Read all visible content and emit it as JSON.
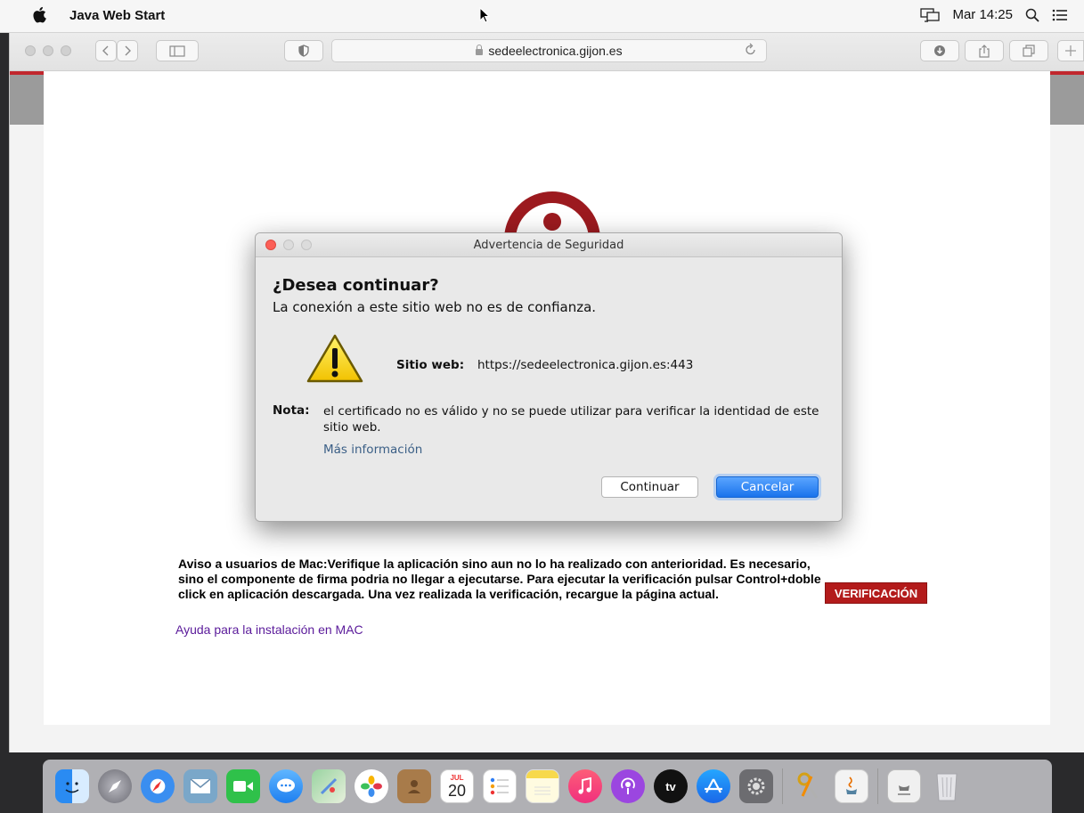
{
  "menubar": {
    "app_name": "Java Web Start",
    "clock": "Mar 14:25"
  },
  "browser": {
    "url": "sedeelectronica.gijon.es"
  },
  "dialog": {
    "title": "Advertencia de Seguridad",
    "question": "¿Desea continuar?",
    "subtitle": "La conexión a este sitio web no es de confianza.",
    "site_label": "Sitio web:",
    "site_url": "https://sedeelectronica.gijon.es:443",
    "note_label": "Nota:",
    "note_text": "el certificado no es válido y no se puede utilizar para verificar la identidad de este sitio web.",
    "more_info": "Más información",
    "continue_label": "Continuar",
    "cancel_label": "Cancelar"
  },
  "page": {
    "notice": "Aviso a usuarios de Mac:Verifique la aplicación sino aun no lo ha realizado con anterioridad. Es necesario, sino el componente de firma podria no llegar a ejecutarse. Para ejecutar la verificación pulsar Control+doble click en aplicación descargada. Una vez realizada la verificación, recargue la página actual.",
    "help_link": "Ayuda para la instalación en MAC",
    "verify_button": "VERIFICACIÓN"
  },
  "dock": {
    "calendar_month": "JUL",
    "calendar_day": "20",
    "tv_label": "tv",
    "items": [
      "finder",
      "launchpad",
      "safari",
      "mail",
      "facetime",
      "messages",
      "maps",
      "photos",
      "contacts",
      "calendar",
      "reminders",
      "notes",
      "music",
      "podcasts",
      "tv",
      "app-store",
      "system-preferences",
      "keychain",
      "java",
      "jnlp-launcher",
      "trash"
    ]
  },
  "colors": {
    "accent_red": "#b31b1b",
    "cancel_blue": "#1a73ec",
    "link_purple": "#5a1a9a"
  }
}
